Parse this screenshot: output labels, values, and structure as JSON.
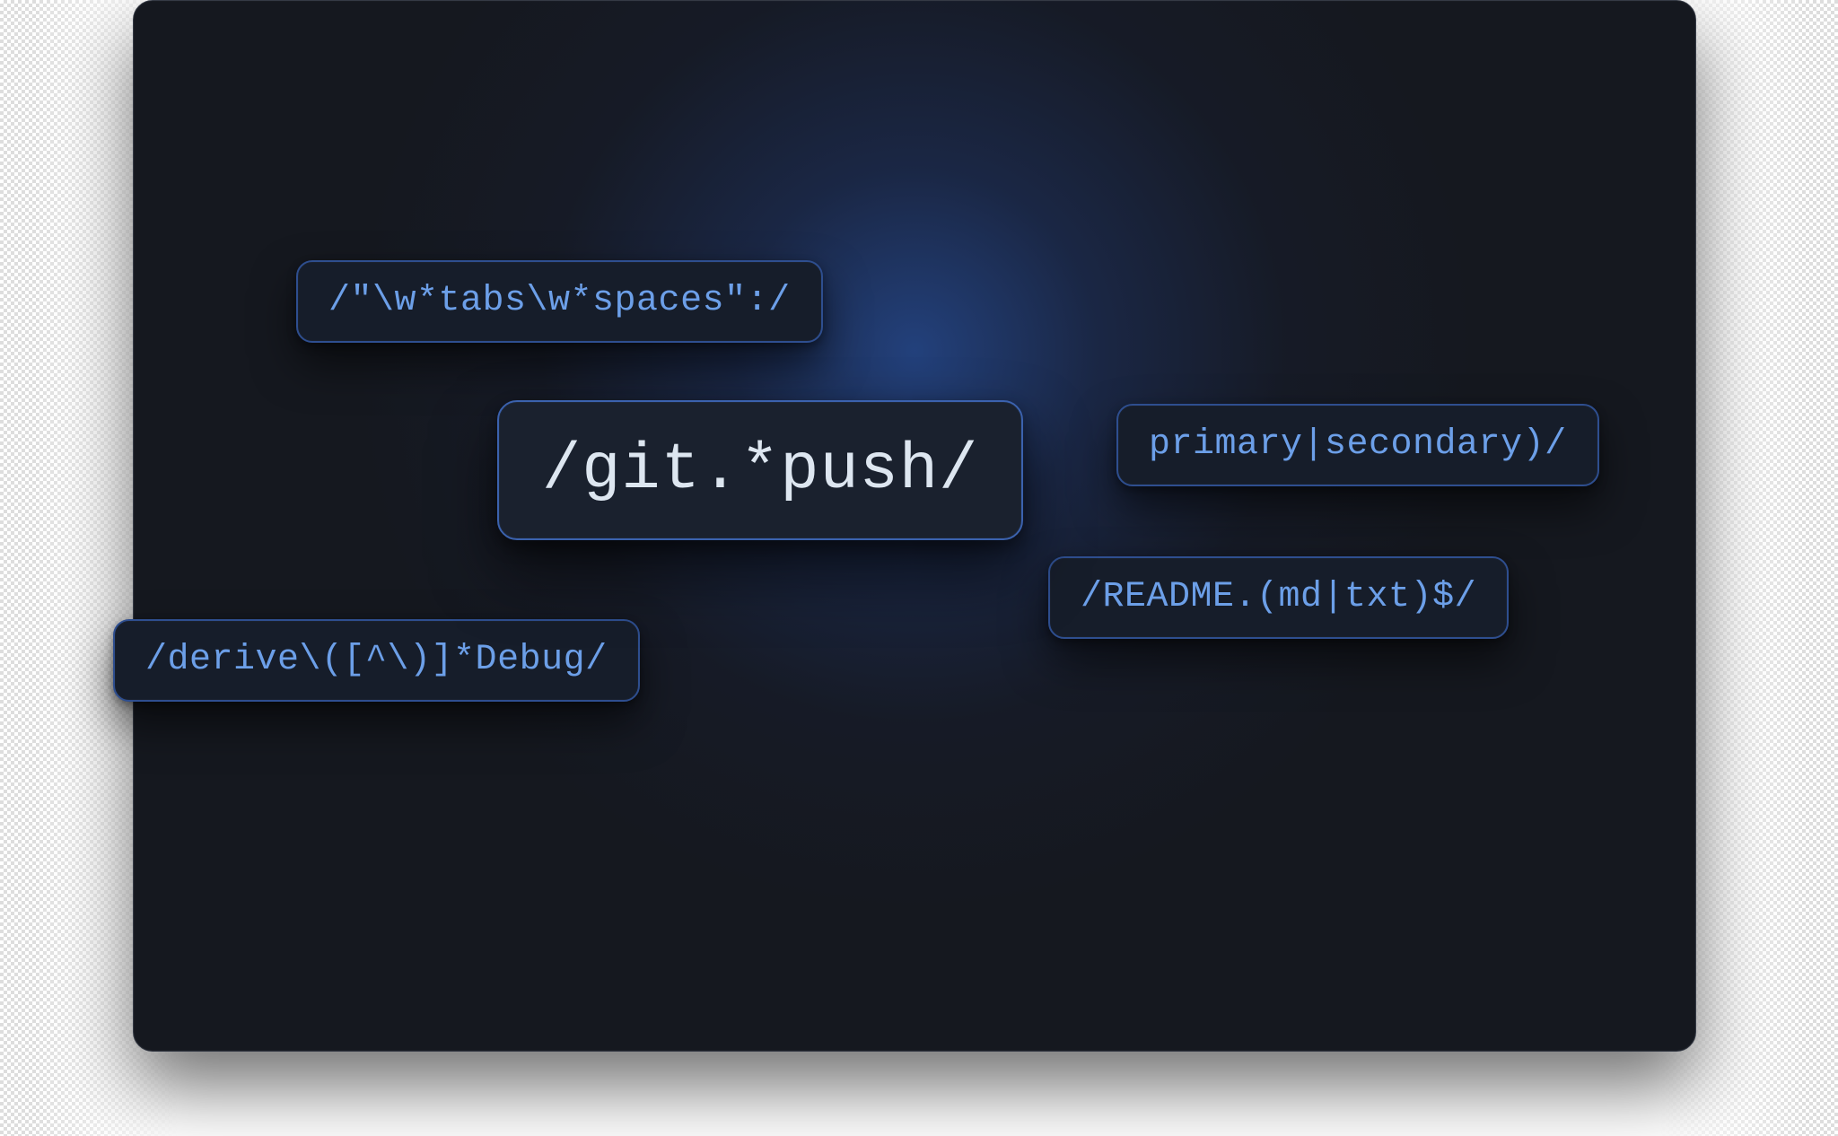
{
  "regex_chips": {
    "tabs_spaces": "/\"\\w*tabs\\w*spaces\":/",
    "git_push": "/git.*push/",
    "primary_secondary": "primary|secondary)/",
    "readme": "/README.(md|txt)$/",
    "derive_debug": "/derive\\([^\\)]*Debug/"
  },
  "colors": {
    "panel_bg": "#15181F",
    "chip_bg": "#161D2A",
    "chip_border": "#2E4E8F",
    "chip_text": "#6C9FE8",
    "hero_text": "#DDE6F0"
  }
}
